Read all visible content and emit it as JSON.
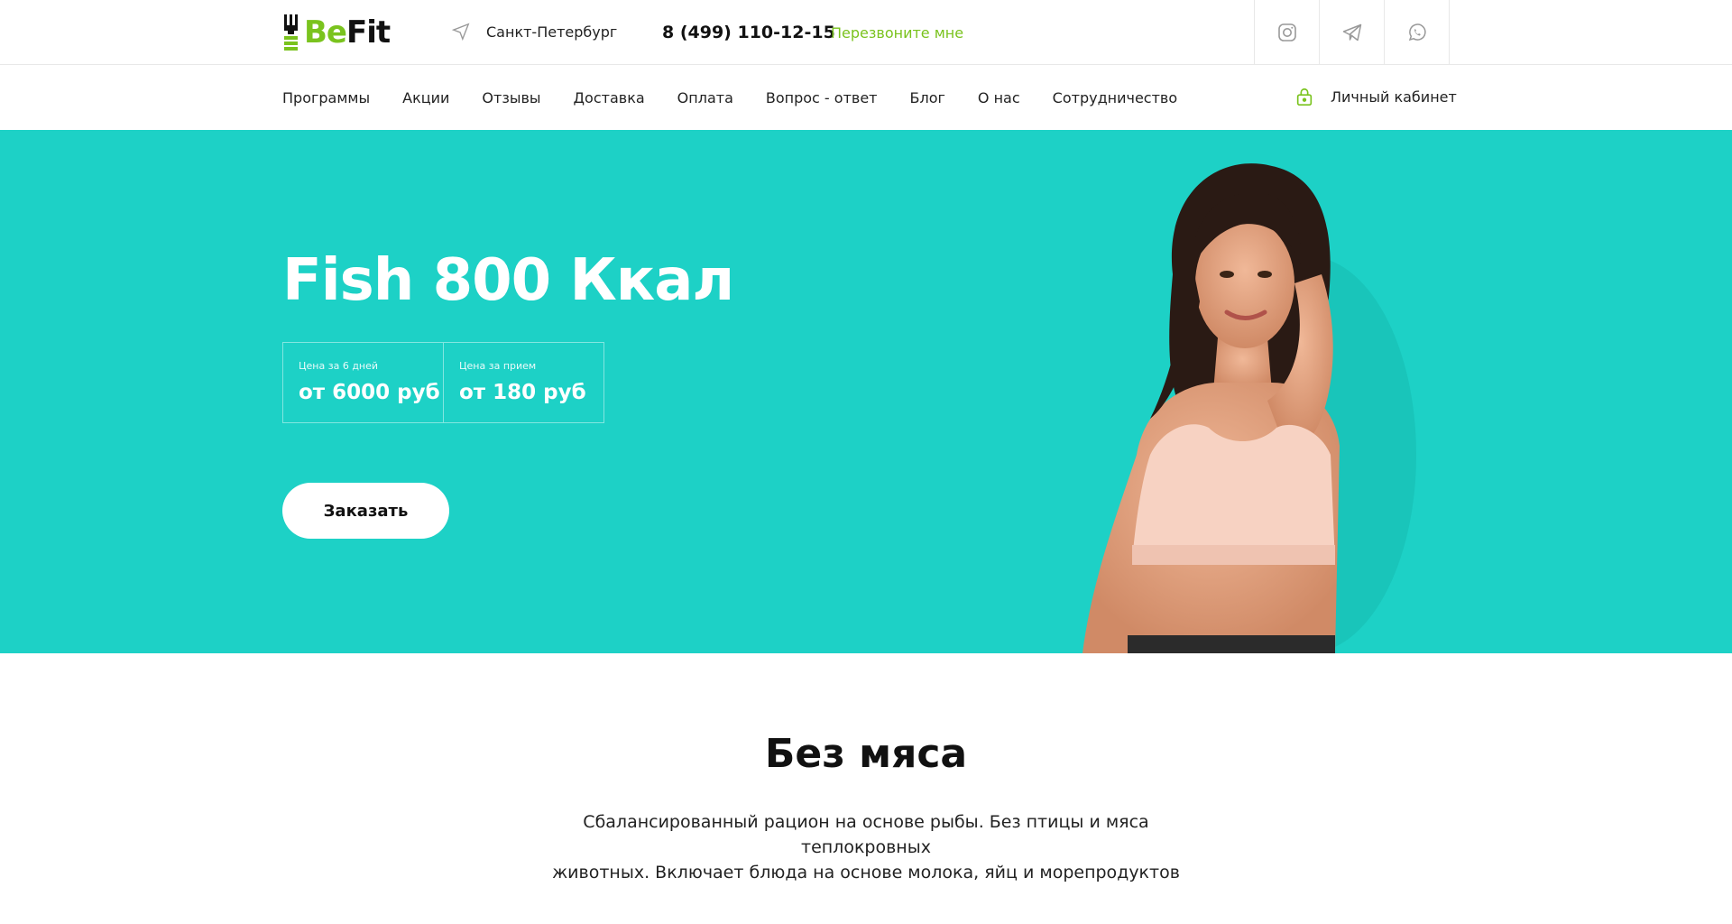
{
  "header": {
    "logo": {
      "part1": "Be",
      "part2": "Fit"
    },
    "city": "Санкт-Петербург",
    "phone": "8 (499) 110-12-15",
    "callback": "Перезвоните мне",
    "socials": [
      "instagram-icon",
      "telegram-icon",
      "whatsapp-icon"
    ]
  },
  "nav": {
    "items": [
      "Программы",
      "Акции",
      "Отзывы",
      "Доставка",
      "Оплата",
      "Вопрос - ответ",
      "Блог",
      "О нас",
      "Сотрудничество"
    ],
    "cabinet": "Личный кабинет"
  },
  "hero": {
    "title": "Fish 800 Ккал",
    "prices": [
      {
        "label": "Цена за 6 дней",
        "value": "от 6000 руб"
      },
      {
        "label": "Цена за прием",
        "value": "от 180 руб"
      }
    ],
    "order_button": "Заказать",
    "background_color": "#1dd1c6"
  },
  "section": {
    "title": "Без мяса",
    "description_line1": "Сбалансированный рацион на основе рыбы. Без птицы и мяса теплокровных",
    "description_line2": "животных. Включает блюда на основе молока, яйц и морепродуктов"
  },
  "colors": {
    "accent": "#7ac31e",
    "hero": "#1dd1c6"
  }
}
